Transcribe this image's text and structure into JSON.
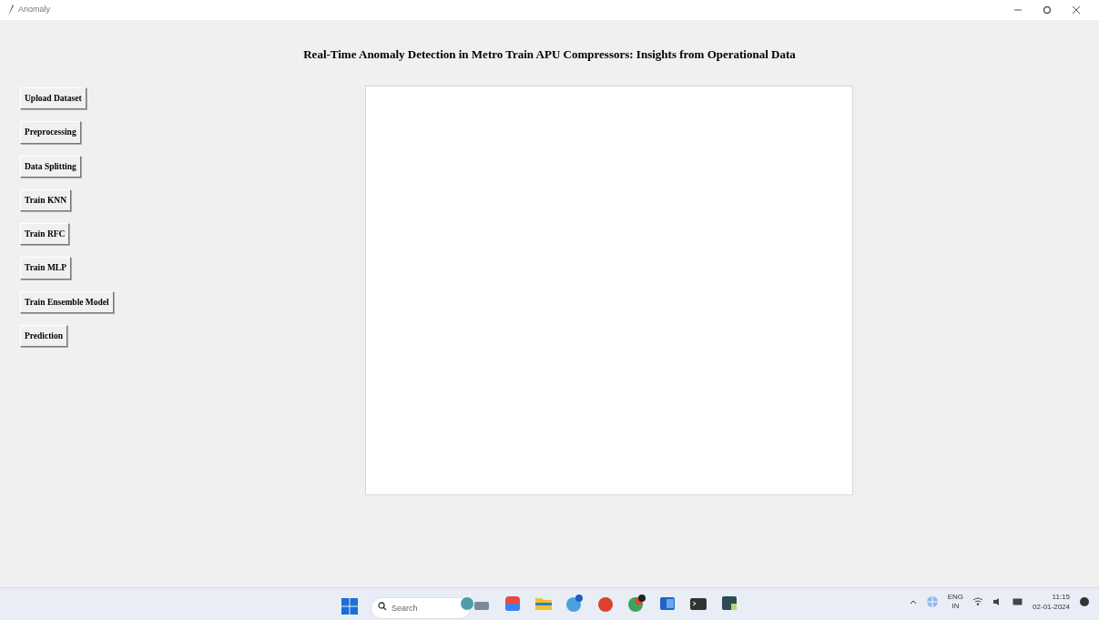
{
  "window": {
    "title": "Anomaly"
  },
  "heading": "Real-Time Anomaly Detection in Metro Train APU Compressors: Insights from Operational Data",
  "buttons": [
    "Upload Dataset",
    "Preprocessing",
    "Data Splitting",
    "Train KNN",
    "Train RFC",
    "Train MLP",
    "Train Ensemble Model",
    "Prediction"
  ],
  "taskbar": {
    "search": {
      "placeholder": "Search"
    },
    "language": "ENG",
    "region": "IN",
    "time": "11:15",
    "date": "02-01-2024"
  }
}
